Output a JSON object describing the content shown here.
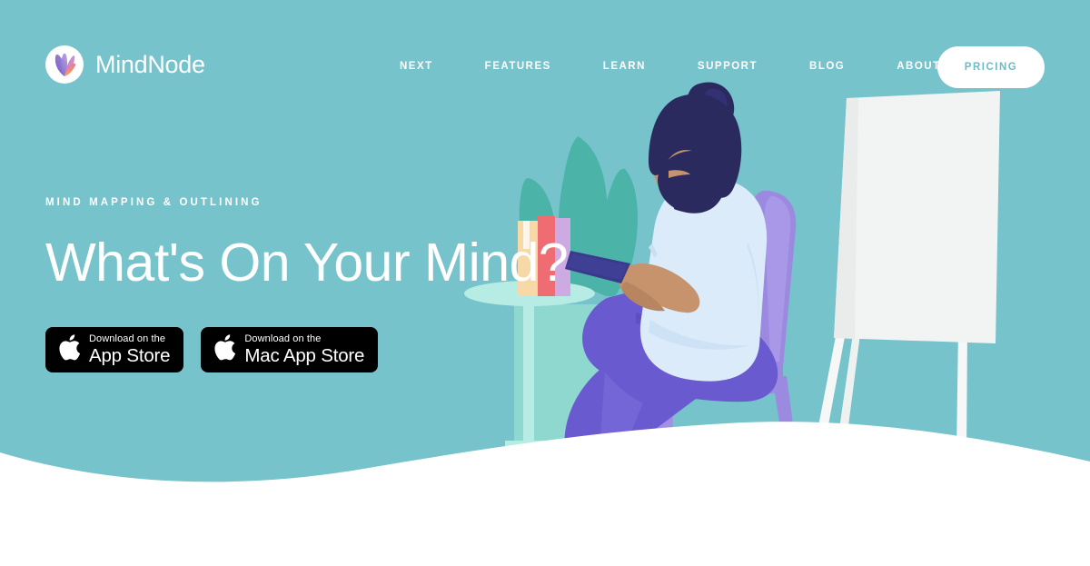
{
  "theme": {
    "background_teal": "#76c3cb",
    "wave_white": "#ffffff",
    "accent_purple": "#8b7ad4",
    "pants_purple": "#6a5ad0",
    "shirt_blue": "#d9eaf8",
    "hair_navy": "#2b2a5f",
    "skin_tan": "#c7936c",
    "plant_teal": "#4cb3a9",
    "table_mint": "#a8e6dd",
    "board_white": "#f2f4f3",
    "pricing_text": "#6dbcc6",
    "badge_black": "#000000"
  },
  "header": {
    "brand": {
      "name": "MindNode",
      "mark_icon": "mindnode-petal-logo-icon"
    },
    "nav": [
      {
        "label": "NEXT",
        "name": "nav-link-next"
      },
      {
        "label": "FEATURES",
        "name": "nav-link-features"
      },
      {
        "label": "LEARN",
        "name": "nav-link-learn"
      },
      {
        "label": "SUPPORT",
        "name": "nav-link-support"
      },
      {
        "label": "BLOG",
        "name": "nav-link-blog"
      },
      {
        "label": "ABOUT",
        "name": "nav-link-about"
      }
    ],
    "pricing_button": "PRICING"
  },
  "hero": {
    "eyebrow": "MIND MAPPING & OUTLINING",
    "headline": "What's On Your Mind?",
    "badges": [
      {
        "small": "Download on the",
        "big": "App Store",
        "icon": "apple-logo-icon",
        "name": "app-store-badge"
      },
      {
        "small": "Download on the",
        "big": "Mac App Store",
        "icon": "apple-logo-icon",
        "name": "mac-app-store-badge"
      }
    ]
  },
  "illustration": {
    "description": "Bearded man with hair bun sitting on a purple chair reading a tablet, next to a side table with three books and a potted plant, with a blank flipchart easel behind him",
    "elements": [
      "plant-leaves",
      "side-table",
      "books-stack",
      "seated-person",
      "tablet-device",
      "chair",
      "flipchart-easel",
      "bottom-wave"
    ]
  }
}
